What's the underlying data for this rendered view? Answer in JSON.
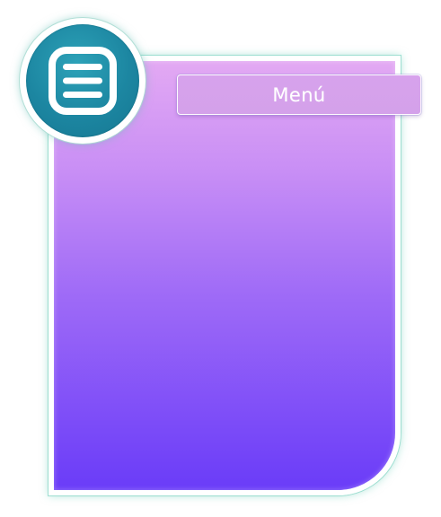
{
  "menu": {
    "label": "Menú",
    "icon": "hamburger-menu-icon"
  },
  "colors": {
    "panel_gradient_top": "#e3a9f3",
    "panel_gradient_bottom": "#6a3cf8",
    "menu_bar_bg": "#d7a2ec",
    "menu_button_bg": "#1c86a1",
    "panel_glow": "#96dccd"
  }
}
